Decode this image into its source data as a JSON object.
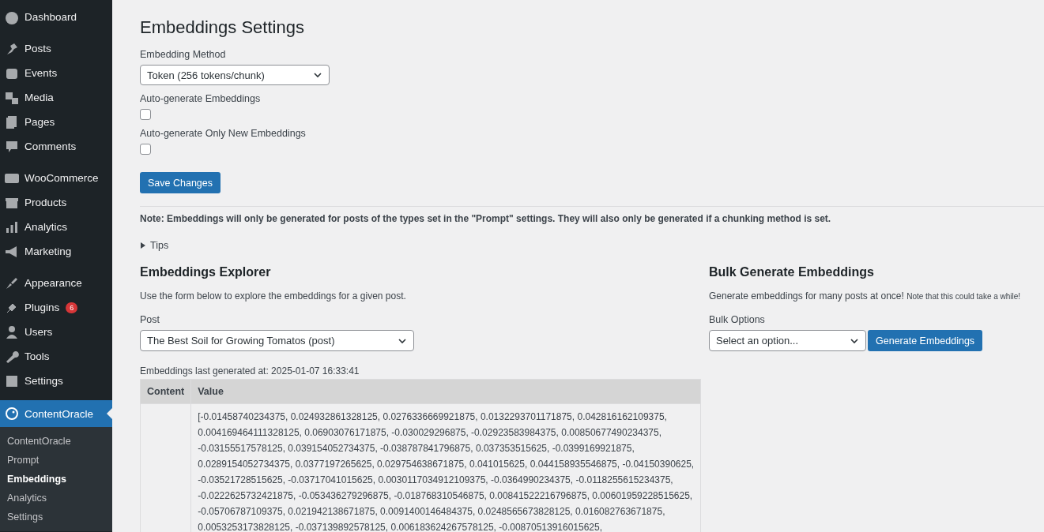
{
  "sidebar": {
    "groups": [
      [
        {
          "label": "Dashboard",
          "selected": false
        }
      ],
      [
        {
          "label": "Posts",
          "selected": false
        },
        {
          "label": "Events",
          "selected": false
        },
        {
          "label": "Media",
          "selected": false
        },
        {
          "label": "Pages",
          "selected": false
        },
        {
          "label": "Comments",
          "selected": false
        }
      ],
      [
        {
          "label": "WooCommerce",
          "selected": false
        },
        {
          "label": "Products",
          "selected": false
        },
        {
          "label": "Analytics",
          "selected": false
        },
        {
          "label": "Marketing",
          "selected": false
        }
      ],
      [
        {
          "label": "Appearance",
          "selected": false
        },
        {
          "label": "Plugins",
          "selected": false,
          "badge": "6"
        },
        {
          "label": "Users",
          "selected": false
        },
        {
          "label": "Tools",
          "selected": false
        },
        {
          "label": "Settings",
          "selected": false
        }
      ],
      [
        {
          "label": "ContentOracle",
          "selected": true,
          "submenu": [
            {
              "label": "ContentOracle",
              "selected": false
            },
            {
              "label": "Prompt",
              "selected": false
            },
            {
              "label": "Embeddings",
              "selected": true
            },
            {
              "label": "Analytics",
              "selected": false
            },
            {
              "label": "Settings",
              "selected": false
            }
          ]
        }
      ]
    ]
  },
  "page": {
    "title": "Embeddings Settings",
    "fields": [
      {
        "kind": "select",
        "label": "Embedding Method",
        "value": "Token (256 tokens/chunk)"
      },
      {
        "kind": "checkbox",
        "label": "Auto-generate Embeddings",
        "checked": false
      },
      {
        "kind": "checkbox",
        "label": "Auto-generate Only New Embeddings",
        "checked": false
      }
    ],
    "save_button": "Save Changes",
    "note": "Note: Embeddings will only be generated for posts of the types set in the \"Prompt\" settings. They will also only be generated if a chunking method is set.",
    "tips": {
      "label": "Tips",
      "expanded": false
    }
  },
  "explorer": {
    "title": "Embeddings Explorer",
    "description": "Use the form below to explore the embeddings for a given post.",
    "post_label": "Post",
    "post_value": "The Best Soil for Growing Tomatos (post)",
    "last_generated": "Embeddings last generated at: 2025-01-07 16:33:41",
    "table": {
      "columns": [
        "Content",
        "Value"
      ],
      "rows": [
        {
          "content": "",
          "value_lines": [
            "[-0.01458740234375, 0.024932861328125, 0.0276336669921875, 0.0132293701171875, 0.042816162109375,",
            "0.004169464111328125, 0.06903076171875, -0.030029296875, -0.02923583984375, 0.00850677490234375,",
            "-0.03155517578125, 0.039154052734375, -0.038787841796875, 0.037353515625, -0.0399169921875,",
            "0.0289154052734375, 0.0377197265625, 0.029754638671875, 0.041015625, 0.044158935546875, -0.04150390625,",
            "-0.03521728515625, -0.03717041015625, 0.0030117034912109375, -0.0364990234375, -0.0118255615234375,",
            "-0.0222625732421875, -0.053436279296875, -0.018768310546875, 0.00841522216796875, 0.00601959228515625,",
            "-0.05706787109375, 0.021942138671875, 0.0091400146484375, 0.0248565673828125, 0.016082763671875,",
            "0.0053253173828125, -0.037139892578125, 0.006183624267578125, -0.00870513916015625,"
          ]
        }
      ]
    }
  },
  "bulk": {
    "title": "Bulk Generate Embeddings",
    "description": "Generate embeddings for many posts at once!",
    "small_note": "Note that this could take a while!",
    "options_label": "Bulk Options",
    "placeholder": "Select an option...",
    "button": "Generate Embeddings"
  }
}
